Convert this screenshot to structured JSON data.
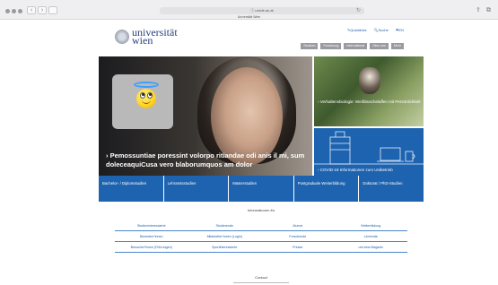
{
  "browser": {
    "url": "ⓘ univie.ac.at",
    "tab_title": "Universität Wien",
    "back": "‹",
    "forward": "›",
    "reload": "↻"
  },
  "header": {
    "logo_line1": "universität",
    "logo_line2": "wien",
    "top_links": [
      "✎Quicklinks",
      "🔍Suche",
      "⚑EN"
    ],
    "menu": [
      "Studium",
      "Forschung",
      "International",
      "Über uns",
      "Mehr"
    ]
  },
  "hero": {
    "caption": "› Pemossuntiae poressint volorpo ritiandae odi anis il mi, sum doleceaquiCusa vero blaborumquos am dolor"
  },
  "side_features": [
    {
      "caption": "› Verhaltensbiologie: Weißbüschelaffen mit Persönlichkeit"
    },
    {
      "caption": "› COVID-19 Informationen zum Unibetrieb"
    }
  ],
  "studies": [
    "Bachelor- / Diplomstudien",
    "Lehramtsstudien",
    "Masterstudien",
    "Postgraduale Weiterbildung",
    "Doktorat / PhD-Studien"
  ],
  "info": {
    "title": "Informationen für",
    "rows": [
      [
        "Studieninteressierte",
        "Studierende",
        "Alumni",
        "Weiterbildung"
      ],
      [
        "Bewerber*innen",
        "Mitarbeiter*innen (Login)",
        "Forschende",
        "Lehrende"
      ],
      [
        "Besucher*innen (Führungen)",
        "Sportinteressierte",
        "Presse",
        "uni:view Magazin"
      ]
    ]
  },
  "footer": {
    "contact": "Contact"
  }
}
